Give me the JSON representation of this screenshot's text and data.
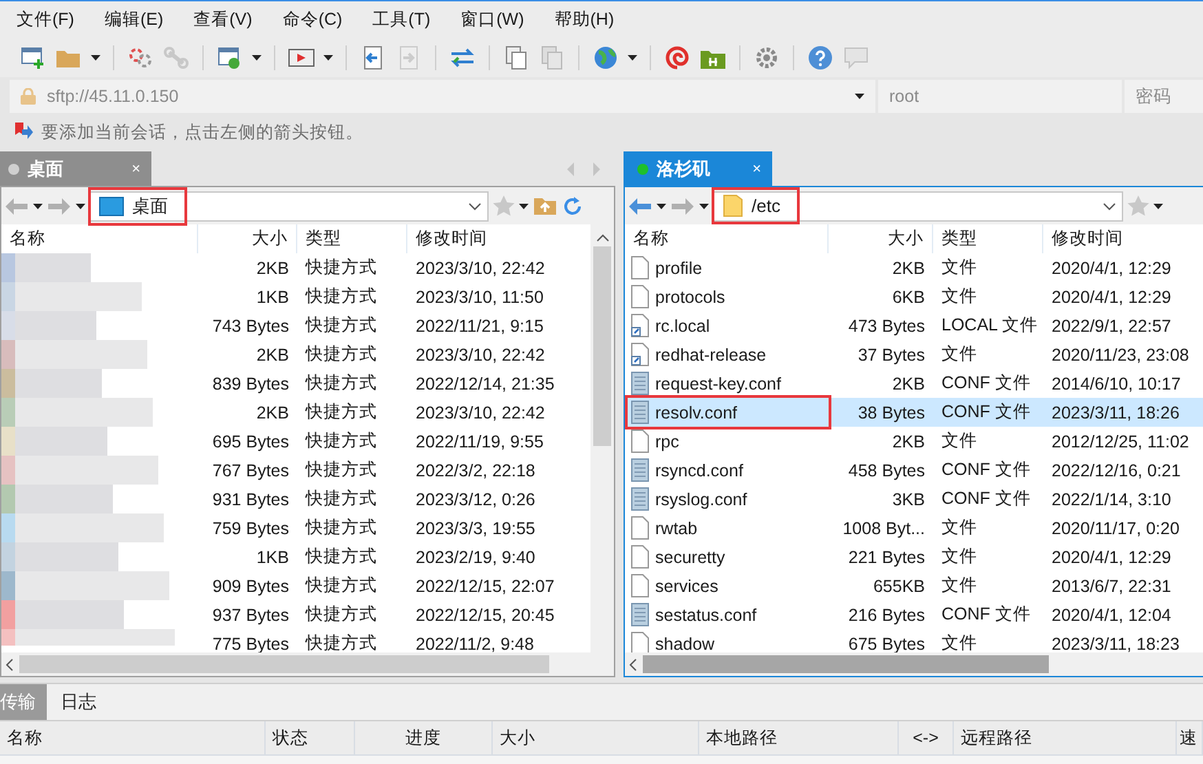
{
  "menu": [
    {
      "label": "文件(F)"
    },
    {
      "label": "编辑(E)"
    },
    {
      "label": "查看(V)"
    },
    {
      "label": "命令(C)"
    },
    {
      "label": "工具(T)"
    },
    {
      "label": "窗口(W)"
    },
    {
      "label": "帮助(H)"
    }
  ],
  "connection": {
    "address": "sftp://45.11.0.150",
    "user_placeholder": "root",
    "password_placeholder": "密码"
  },
  "hint": "要添加当前会话，点击左侧的箭头按钮。",
  "panes": [
    {
      "tab": {
        "label": "桌面",
        "close": "×",
        "active": false,
        "connected": false
      },
      "path": {
        "label": "桌面",
        "kind": "desktop",
        "highlighted": true
      },
      "columns": [
        "名称",
        "大小",
        "类型",
        "修改时间"
      ],
      "names_blurred": true,
      "vertical_scrollbar": true,
      "rows": [
        {
          "size": "2KB",
          "type": "快捷方式",
          "modified": "2023/3/10, 22:42",
          "selected": false,
          "highlighted": false
        },
        {
          "size": "1KB",
          "type": "快捷方式",
          "modified": "2023/3/10, 11:50",
          "selected": false,
          "highlighted": false
        },
        {
          "size": "743 Bytes",
          "type": "快捷方式",
          "modified": "2022/11/21, 9:15",
          "selected": false,
          "highlighted": false
        },
        {
          "size": "2KB",
          "type": "快捷方式",
          "modified": "2023/3/10, 22:42",
          "selected": false,
          "highlighted": false
        },
        {
          "size": "839 Bytes",
          "type": "快捷方式",
          "modified": "2022/12/14, 21:35",
          "selected": false,
          "highlighted": false
        },
        {
          "size": "2KB",
          "type": "快捷方式",
          "modified": "2023/3/10, 22:42",
          "selected": false,
          "highlighted": false
        },
        {
          "size": "695 Bytes",
          "type": "快捷方式",
          "modified": "2022/11/19, 9:55",
          "selected": false,
          "highlighted": false
        },
        {
          "size": "767 Bytes",
          "type": "快捷方式",
          "modified": "2022/3/2, 22:18",
          "selected": false,
          "highlighted": false
        },
        {
          "size": "931 Bytes",
          "type": "快捷方式",
          "modified": "2023/3/12, 0:26",
          "selected": false,
          "highlighted": false
        },
        {
          "size": "759 Bytes",
          "type": "快捷方式",
          "modified": "2023/3/3, 19:55",
          "selected": false,
          "highlighted": false
        },
        {
          "size": "1KB",
          "type": "快捷方式",
          "modified": "2023/2/19, 9:40",
          "selected": false,
          "highlighted": false
        },
        {
          "size": "909 Bytes",
          "type": "快捷方式",
          "modified": "2022/12/15, 22:07",
          "selected": false,
          "highlighted": false
        },
        {
          "size": "937 Bytes",
          "type": "快捷方式",
          "modified": "2022/12/15, 20:45",
          "selected": false,
          "highlighted": false
        },
        {
          "size": "775 Bytes",
          "type": "快捷方式",
          "modified": "2022/11/2, 9:48",
          "selected": false,
          "highlighted": false
        }
      ]
    },
    {
      "tab": {
        "label": "洛杉矶",
        "close": "×",
        "active": true,
        "connected": true
      },
      "path": {
        "label": "/etc",
        "kind": "folder",
        "highlighted": true
      },
      "columns": [
        "名称",
        "大小",
        "类型",
        "修改时间"
      ],
      "names_blurred": false,
      "vertical_scrollbar": false,
      "rows": [
        {
          "name": "profile",
          "kind": "file",
          "size": "2KB",
          "type": "文件",
          "modified": "2020/4/1, 12:29",
          "selected": false,
          "highlighted": false
        },
        {
          "name": "protocols",
          "kind": "file",
          "size": "6KB",
          "type": "文件",
          "modified": "2020/4/1, 12:29",
          "selected": false,
          "highlighted": false
        },
        {
          "name": "rc.local",
          "kind": "link",
          "size": "473 Bytes",
          "type": "LOCAL 文件",
          "modified": "2022/9/1, 22:57",
          "selected": false,
          "highlighted": false
        },
        {
          "name": "redhat-release",
          "kind": "link",
          "size": "37 Bytes",
          "type": "文件",
          "modified": "2020/11/23, 23:08",
          "selected": false,
          "highlighted": false
        },
        {
          "name": "request-key.conf",
          "kind": "conf",
          "size": "2KB",
          "type": "CONF 文件",
          "modified": "2014/6/10, 10:17",
          "selected": false,
          "highlighted": false
        },
        {
          "name": "resolv.conf",
          "kind": "conf",
          "size": "38 Bytes",
          "type": "CONF 文件",
          "modified": "2023/3/11, 18:26",
          "selected": true,
          "highlighted": true
        },
        {
          "name": "rpc",
          "kind": "file",
          "size": "2KB",
          "type": "文件",
          "modified": "2012/12/25, 11:02",
          "selected": false,
          "highlighted": false
        },
        {
          "name": "rsyncd.conf",
          "kind": "conf",
          "size": "458 Bytes",
          "type": "CONF 文件",
          "modified": "2022/12/16, 0:21",
          "selected": false,
          "highlighted": false
        },
        {
          "name": "rsyslog.conf",
          "kind": "conf",
          "size": "3KB",
          "type": "CONF 文件",
          "modified": "2022/1/14, 3:10",
          "selected": false,
          "highlighted": false
        },
        {
          "name": "rwtab",
          "kind": "file",
          "size": "1008 Byt...",
          "type": "文件",
          "modified": "2020/11/17, 0:20",
          "selected": false,
          "highlighted": false
        },
        {
          "name": "securetty",
          "kind": "file",
          "size": "221 Bytes",
          "type": "文件",
          "modified": "2020/4/1, 12:29",
          "selected": false,
          "highlighted": false
        },
        {
          "name": "services",
          "kind": "file",
          "size": "655KB",
          "type": "文件",
          "modified": "2013/6/7, 22:31",
          "selected": false,
          "highlighted": false
        },
        {
          "name": "sestatus.conf",
          "kind": "conf",
          "size": "216 Bytes",
          "type": "CONF 文件",
          "modified": "2020/4/1, 12:04",
          "selected": false,
          "highlighted": false
        },
        {
          "name": "shadow",
          "kind": "file",
          "size": "675 Bytes",
          "type": "文件",
          "modified": "2023/3/11, 18:23",
          "selected": false,
          "highlighted": false
        }
      ]
    }
  ],
  "transfer": {
    "tabs": [
      {
        "label": "传输",
        "selected": true
      },
      {
        "label": "日志",
        "selected": false
      }
    ],
    "columns": [
      "名称",
      "状态",
      "进度",
      "大小",
      "本地路径",
      "<->",
      "远程路径",
      "速"
    ]
  }
}
